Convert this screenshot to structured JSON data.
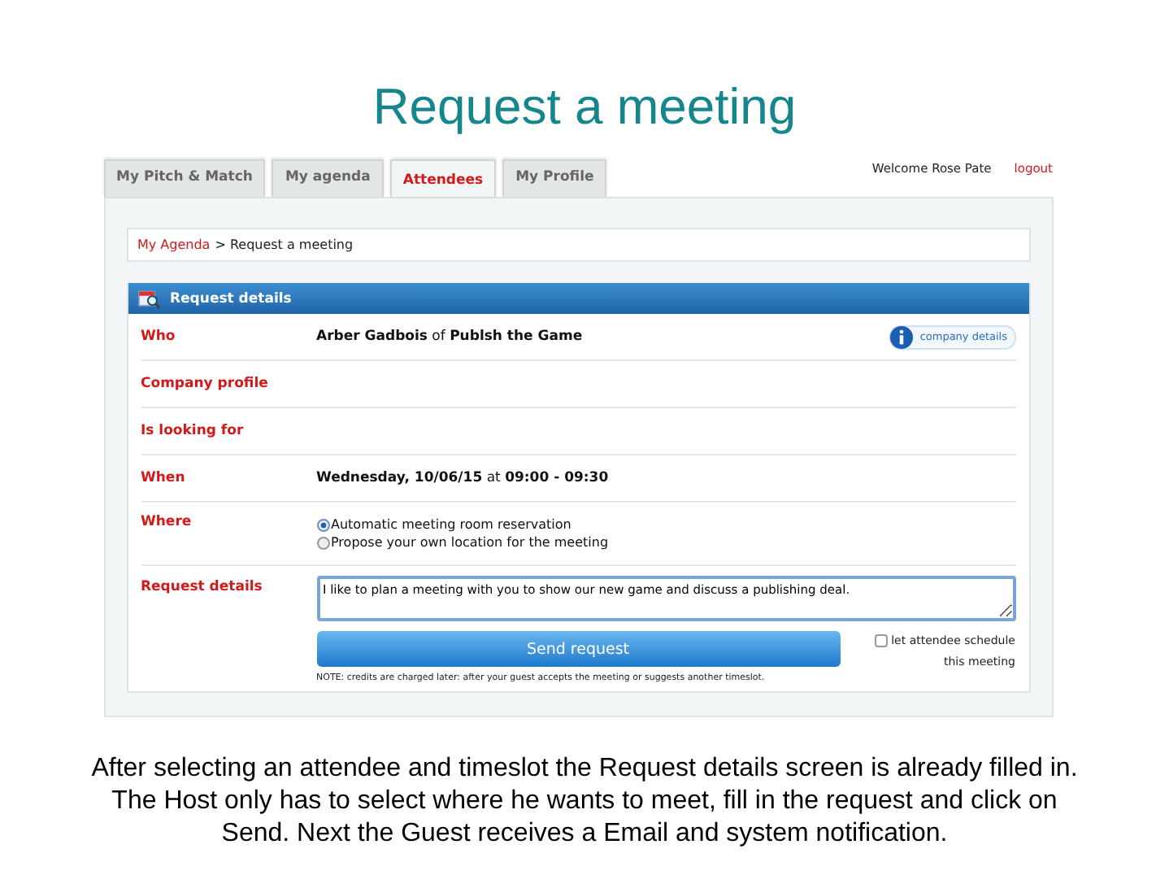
{
  "slide_title": "Request a meeting",
  "tabs": [
    {
      "label": "My Pitch & Match",
      "selected": false
    },
    {
      "label": "My agenda",
      "selected": false
    },
    {
      "label": "Attendees",
      "selected": true
    },
    {
      "label": "My Profile",
      "selected": false
    }
  ],
  "welcome": "Welcome Rose Pate",
  "logout": "logout",
  "breadcrumb": {
    "link": "My Agenda",
    "rest": "> Request a meeting"
  },
  "panel_title": "Request details",
  "rows": [
    {
      "kind": "text",
      "label": "Who",
      "value": "**Arber Gadbois** of **Publsh the Game**",
      "action": "company details"
    },
    {
      "kind": "text",
      "label": "Company profile"
    },
    {
      "kind": "text",
      "label": "Is looking for"
    },
    {
      "kind": "text",
      "label": "When",
      "value": "**Wednesday, 10/06/15** at **09:00 - 09:30**"
    },
    {
      "kind": "radio",
      "label": "Where",
      "options": [
        {
          "label": "Automatic meeting room reservation",
          "selected": true
        },
        {
          "label": "Propose your own location for the meeting",
          "selected": false
        }
      ]
    },
    {
      "kind": "textarea",
      "label": "Request details",
      "value": "I like to plan a meeting with you to show our new game and discuss a publishing deal."
    }
  ],
  "send_button": "Send request",
  "schedule_checkbox": {
    "label": "let attendee schedule this meeting",
    "checked": false
  },
  "note": "NOTE: credits are charged later: after your guest accepts the meeting or suggests another timeslot.",
  "caption": "After selecting an attendee and timeslot the Request details screen is already filled in. The Host only has to select where he wants to meet, fill in the request and click on Send. Next the Guest receives a Email and system notification."
}
